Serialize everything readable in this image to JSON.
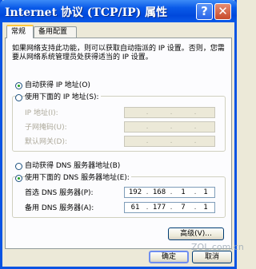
{
  "window": {
    "title": "Internet 协议 (TCP/IP) 属性",
    "help_glyph": "?",
    "close_glyph": "✕"
  },
  "tabs": [
    {
      "label": "常规",
      "active": true
    },
    {
      "label": "备用配置",
      "active": false
    }
  ],
  "description": "如果网络支持此功能，则可以获取自动指派的 IP 设置。否则，您需要从网络系统管理员处获得适当的 IP 设置。",
  "ip_mode": {
    "auto_label": "自动获得 IP 地址(O)",
    "manual_label": "使用下面的 IP 地址(S):",
    "selected": "auto"
  },
  "ip_fields": [
    {
      "label": "IP 地址(I):",
      "value": [
        "",
        "",
        "",
        ""
      ],
      "enabled": false
    },
    {
      "label": "子网掩码(U):",
      "value": [
        "",
        "",
        "",
        ""
      ],
      "enabled": false
    },
    {
      "label": "默认网关(D):",
      "value": [
        "",
        "",
        "",
        ""
      ],
      "enabled": false
    }
  ],
  "dns_mode": {
    "auto_label": "自动获得 DNS 服务器地址(B)",
    "manual_label": "使用下面的 DNS 服务器地址(E):",
    "selected": "manual"
  },
  "dns_fields": [
    {
      "label": "首选 DNS 服务器(P):",
      "value": [
        "192",
        "168",
        "1",
        "1"
      ],
      "enabled": true
    },
    {
      "label": "备用 DNS 服务器(A):",
      "value": [
        "61",
        "177",
        "7",
        "1"
      ],
      "enabled": true
    }
  ],
  "buttons": {
    "advanced": "高级(V)...",
    "ok": "确定",
    "cancel": "取消"
  },
  "watermark": "ZOL.com.cn"
}
